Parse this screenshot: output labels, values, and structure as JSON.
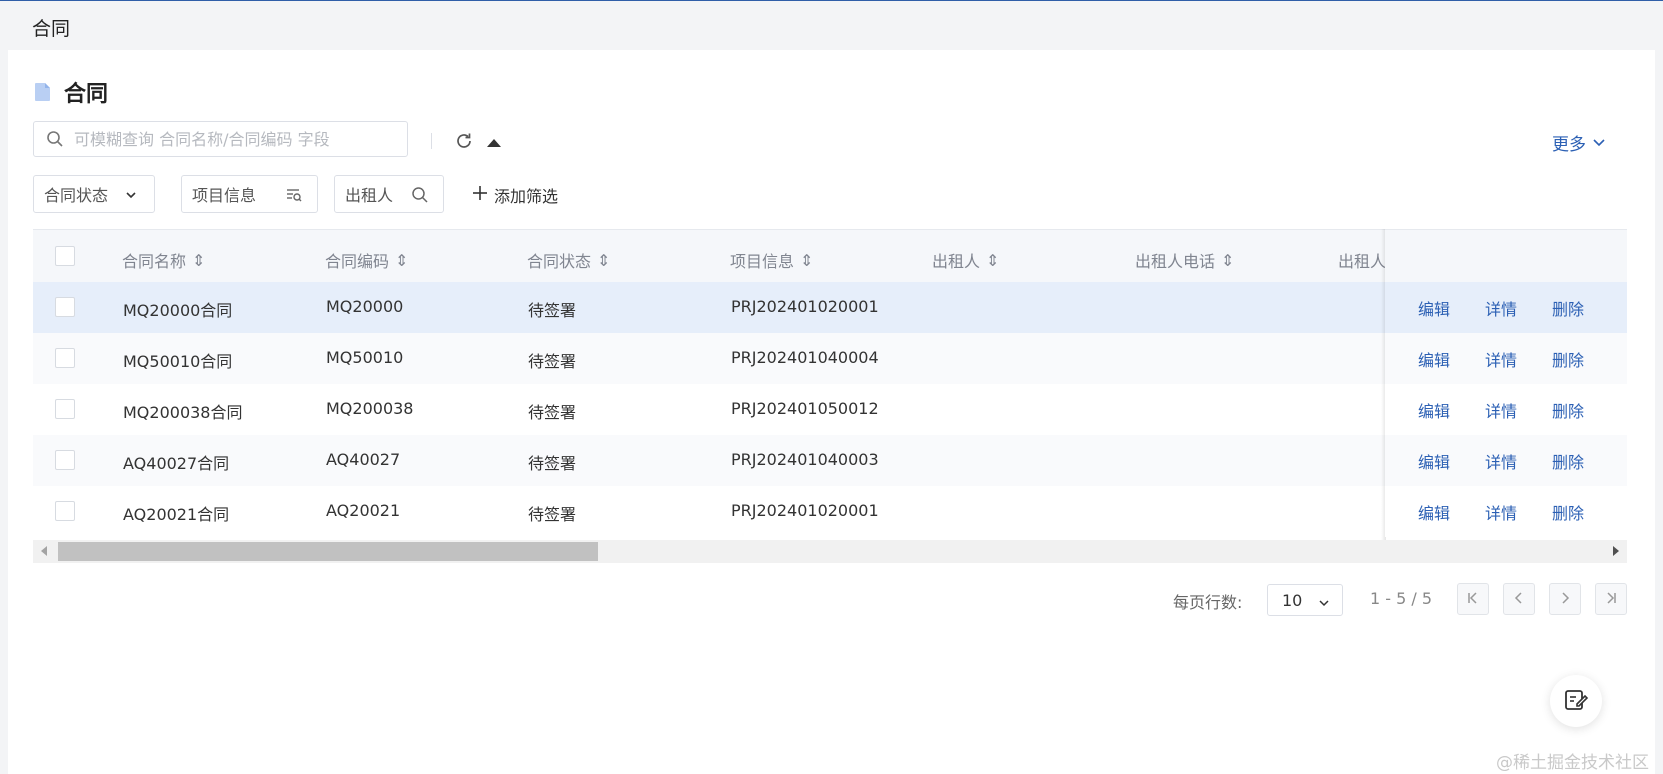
{
  "breadcrumb": "合同",
  "title": "合同",
  "search": {
    "placeholder": "可模糊查询 合同名称/合同编码 字段"
  },
  "more_label": "更多",
  "filters": [
    {
      "label": "合同状态",
      "icon": "chevron-down-icon"
    },
    {
      "label": "项目信息",
      "icon": "filter-search-icon"
    },
    {
      "label": "出租人",
      "icon": "search-icon"
    }
  ],
  "add_filter_label": "添加筛选",
  "table": {
    "columns": [
      "合同名称",
      "合同编码",
      "合同状态",
      "项目信息",
      "出租人",
      "出租人电话",
      "出租人"
    ],
    "rows": [
      {
        "name": "MQ20000合同",
        "code": "MQ20000",
        "status": "待签署",
        "project": "PRJ202401020001"
      },
      {
        "name": "MQ50010合同",
        "code": "MQ50010",
        "status": "待签署",
        "project": "PRJ202401040004"
      },
      {
        "name": "MQ200038合同",
        "code": "MQ200038",
        "status": "待签署",
        "project": "PRJ202401050012"
      },
      {
        "name": "AQ40027合同",
        "code": "AQ40027",
        "status": "待签署",
        "project": "PRJ202401040003"
      },
      {
        "name": "AQ20021合同",
        "code": "AQ20021",
        "status": "待签署",
        "project": "PRJ202401020001"
      }
    ],
    "actions": {
      "edit": "编辑",
      "detail": "详情",
      "delete": "删除"
    }
  },
  "pagination": {
    "rows_per_page_label": "每页行数:",
    "page_size": "10",
    "range": "1 - 5 / 5"
  },
  "watermark": "@稀土掘金技术社区",
  "colors": {
    "accent": "#2c60b4",
    "selected_row": "#e6eefa",
    "stripe_row": "#f9fafc"
  }
}
